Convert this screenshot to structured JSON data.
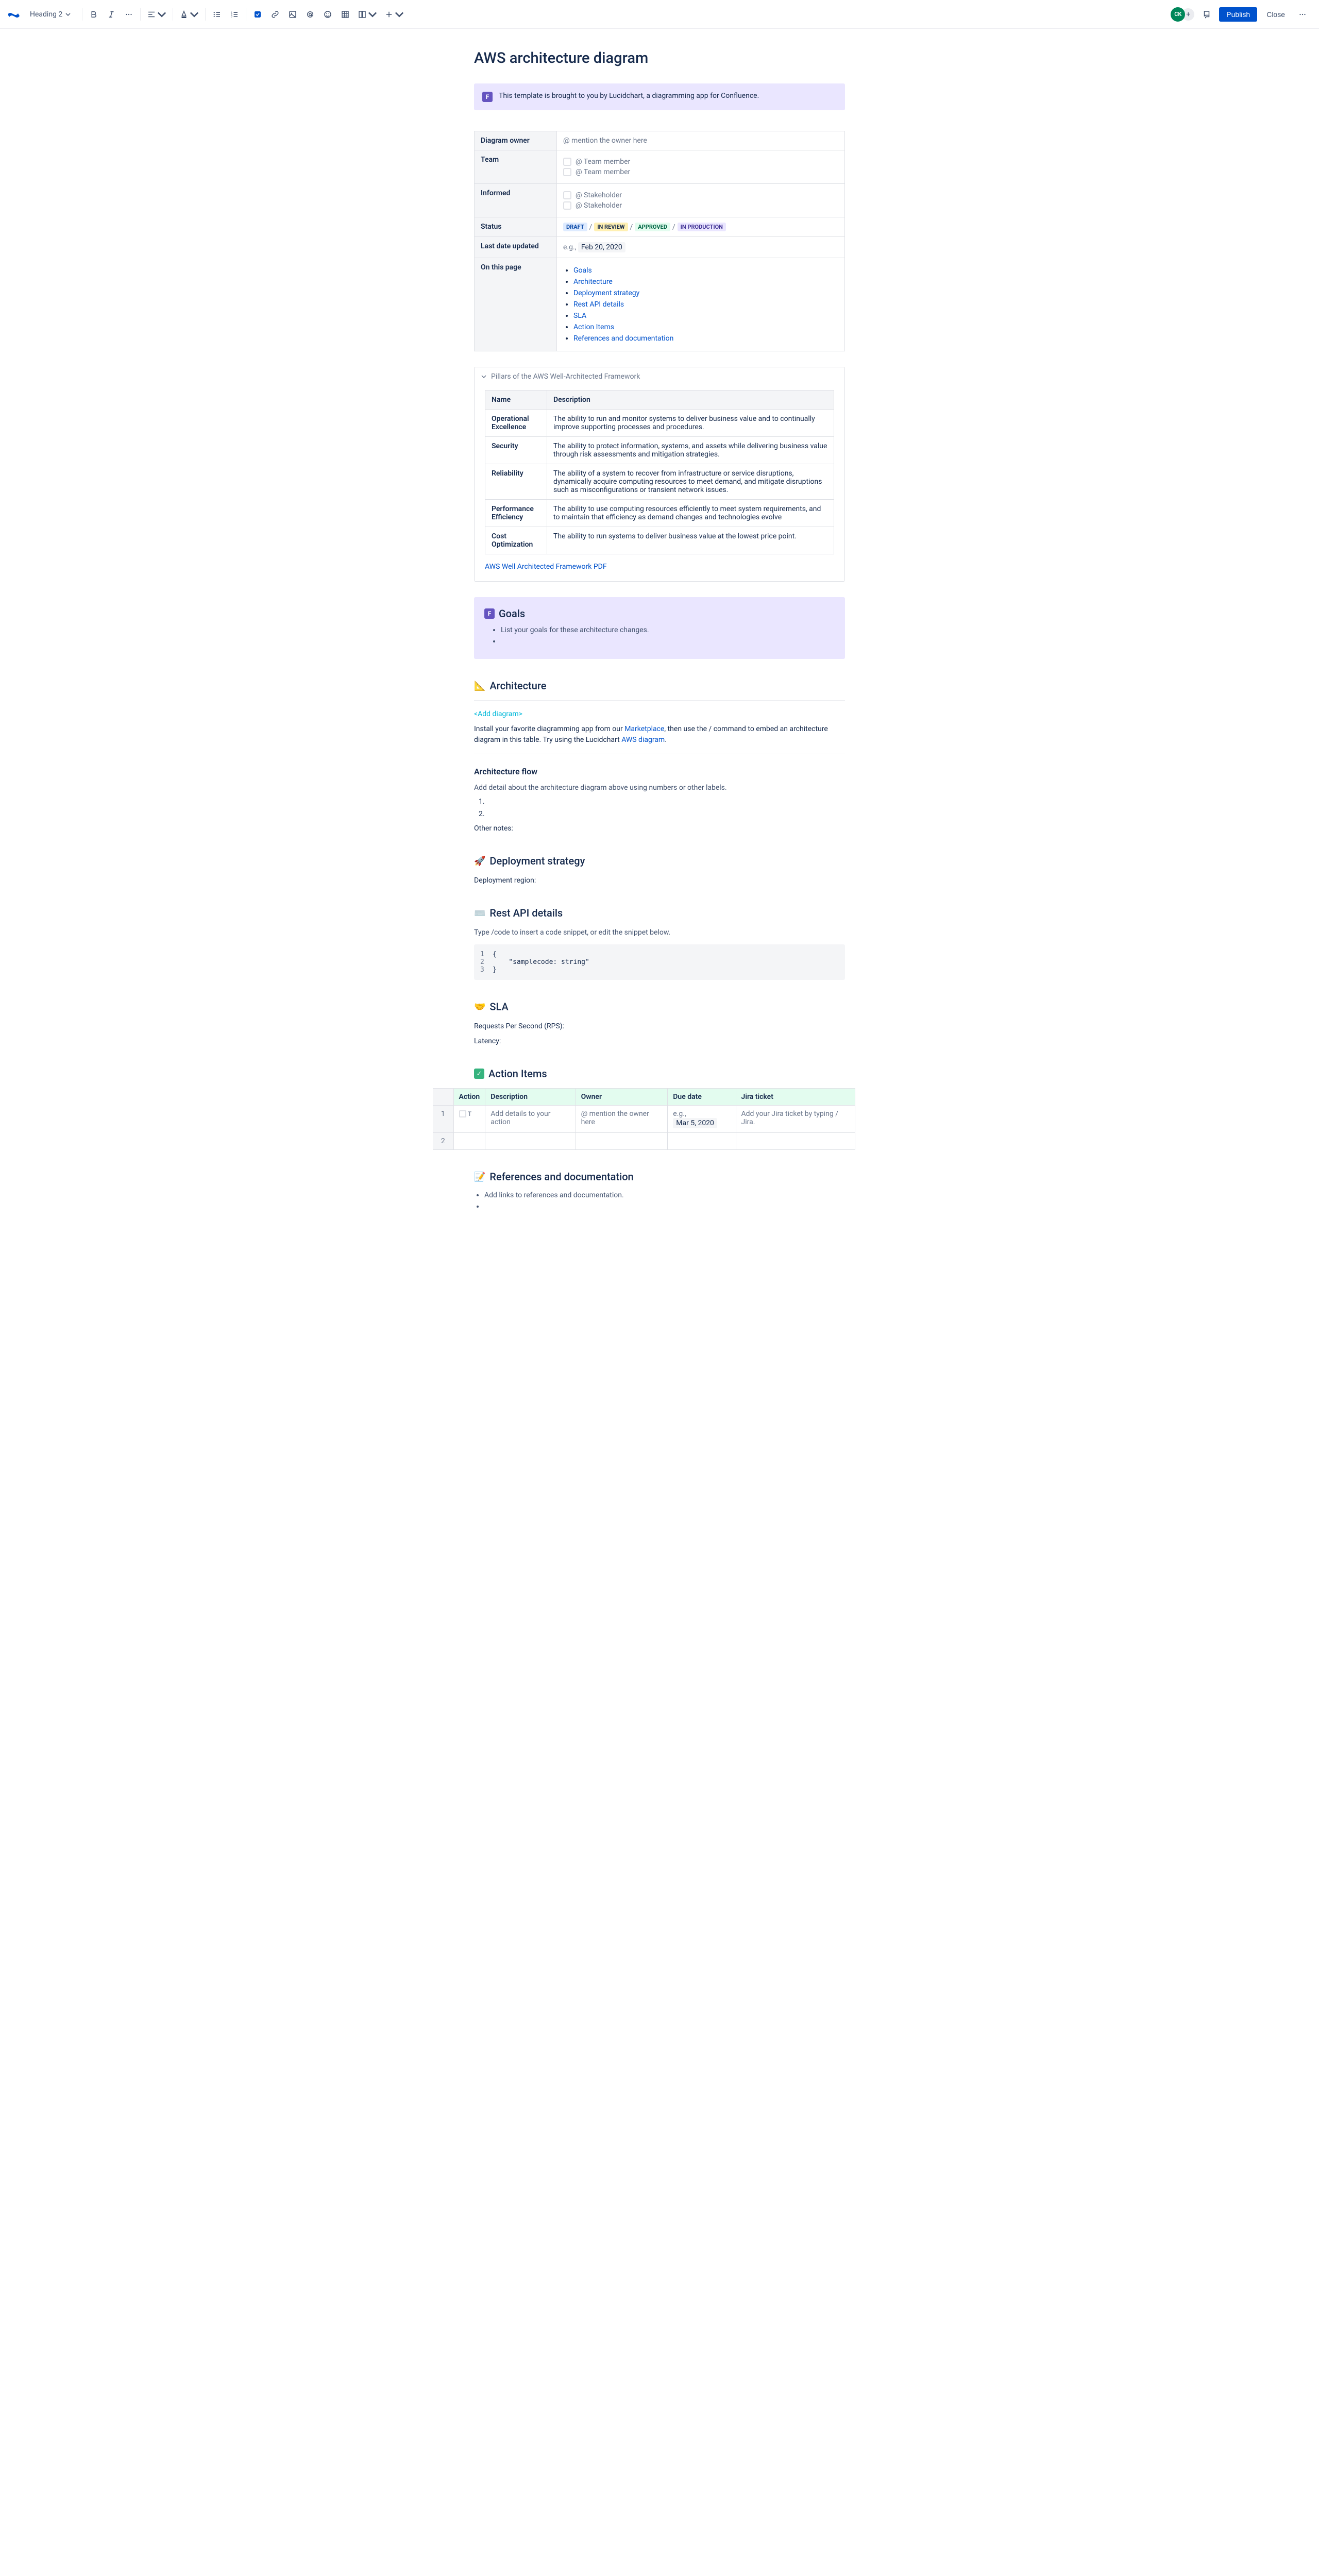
{
  "toolbar": {
    "heading_label": "Heading 2",
    "publish_label": "Publish",
    "close_label": "Close",
    "avatar_initials": "CK"
  },
  "title": "AWS architecture diagram",
  "info_banner": "This template is brought to you by Lucidchart, a diagramming app for Confluence.",
  "meta": {
    "owner_label": "Diagram owner",
    "owner_placeholder": "@ mention the owner here",
    "team_label": "Team",
    "team_member_placeholder": "@ Team member",
    "informed_label": "Informed",
    "stakeholder_placeholder": "@ Stakeholder",
    "status_label": "Status",
    "status_draft": "DRAFT",
    "status_review": "IN REVIEW",
    "status_approved": "APPROVED",
    "status_prod": "IN PRODUCTION",
    "last_updated_label": "Last date updated",
    "last_updated_prefix": "e.g.,",
    "last_updated_date": "Feb 20, 2020",
    "on_page_label": "On this page",
    "toc": [
      "Goals",
      "Architecture",
      "Deployment strategy",
      "Rest API details",
      "SLA",
      "Action Items",
      "References and documentation"
    ]
  },
  "expand": {
    "title": "Pillars of the AWS Well-Architected Framework",
    "headers": {
      "name": "Name",
      "description": "Description"
    },
    "rows": [
      {
        "name": "Operational Excellence",
        "desc": "The ability to run and monitor systems to deliver business value and to continually improve supporting processes and procedures."
      },
      {
        "name": "Security",
        "desc": "The ability to protect information, systems, and assets while delivering business value through risk assessments and mitigation strategies."
      },
      {
        "name": "Reliability",
        "desc": "The ability of a system to recover from infrastructure or service disruptions, dynamically acquire computing resources to meet demand, and mitigate disruptions such as misconfigurations or transient network issues."
      },
      {
        "name": "Performance Efficiency",
        "desc": "The ability to use computing resources efficiently to meet system requirements, and to maintain that efficiency as demand changes and technologies evolve"
      },
      {
        "name": "Cost Optimization",
        "desc": "The ability to run systems to deliver business value at the lowest price point."
      }
    ],
    "link": "AWS Well Architected Framework PDF"
  },
  "goals": {
    "heading": "Goals",
    "item": "List your goals for these architecture changes."
  },
  "architecture": {
    "heading": "Architecture",
    "add_diagram": "<Add diagram>",
    "text_prefix": "Install your favorite diagramming app from our ",
    "marketplace_link": "Marketplace",
    "text_mid": ", then use the / command to embed an architecture diagram in this table. Try using the Lucidchart ",
    "aws_link": "AWS diagram",
    "text_suffix": ".",
    "flow_heading": "Architecture flow",
    "flow_text": "Add detail about the architecture diagram above using numbers or other labels.",
    "other_notes": "Other notes:"
  },
  "deployment": {
    "heading": "Deployment strategy",
    "region_label": "Deployment region:"
  },
  "rest_api": {
    "heading": "Rest API details",
    "hint": "Type /code to insert a code snippet, or edit the snippet below.",
    "code": [
      {
        "n": "1",
        "c": "{"
      },
      {
        "n": "2",
        "c": "    \"samplecode: string\""
      },
      {
        "n": "3",
        "c": "}"
      }
    ]
  },
  "sla": {
    "heading": "SLA",
    "rps": "Requests Per Second (RPS):",
    "latency": "Latency:"
  },
  "actions": {
    "heading": "Action Items",
    "headers": {
      "action": "Action",
      "description": "Description",
      "owner": "Owner",
      "due": "Due date",
      "jira": "Jira ticket"
    },
    "row1": {
      "desc": "Add details to your action",
      "owner": "@ mention the owner here",
      "due_prefix": "e.g.,",
      "due_date": "Mar 5, 2020",
      "jira": "Add your Jira ticket by typing / Jira."
    }
  },
  "references": {
    "heading": "References and documentation",
    "item": "Add links to references and documentation."
  }
}
